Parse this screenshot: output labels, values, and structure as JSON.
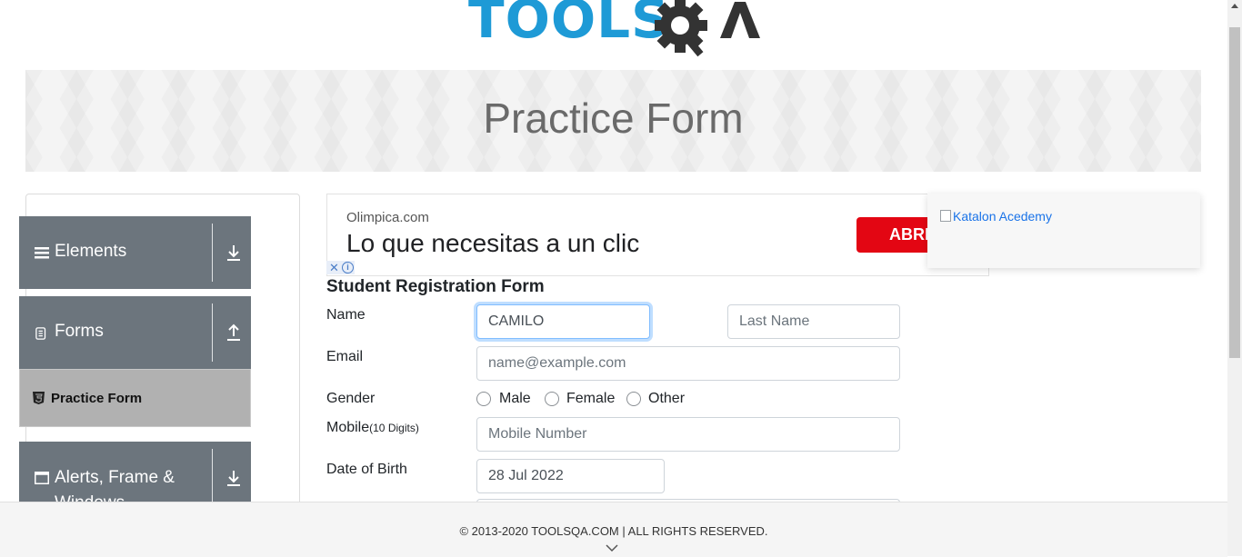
{
  "header": {
    "logo_text": "TOOLS",
    "logo_suffix": "QA"
  },
  "banner": {
    "title": "Practice Form"
  },
  "sidebar": {
    "groups": [
      {
        "label": "Elements",
        "icon": "hamburger-icon",
        "toggle": "download-arrow-icon"
      },
      {
        "label": "Forms",
        "icon": "document-icon",
        "toggle": "upload-arrow-icon"
      },
      {
        "label": "Alerts, Frame & Windows",
        "icon": "window-icon",
        "toggle": "download-arrow-icon"
      }
    ],
    "active_item": {
      "label": "Practice Form",
      "icon": "html5-shield-icon"
    }
  },
  "ad": {
    "domain": "Olimpica.com",
    "headline": "Lo que necesitas a un clic",
    "button_label": "ABRIR"
  },
  "katalon": {
    "alt_text": "Katalon Acedemy"
  },
  "form": {
    "title": "Student Registration Form",
    "name_label": "Name",
    "first_name_value": "CAMILO",
    "last_name_placeholder": "Last Name",
    "email_label": "Email",
    "email_placeholder": "name@example.com",
    "gender_label": "Gender",
    "gender_options": [
      "Male",
      "Female",
      "Other"
    ],
    "mobile_label": "Mobile",
    "mobile_hint": "(10 Digits)",
    "mobile_placeholder": "Mobile Number",
    "dob_label": "Date of Birth",
    "dob_value": "28 Jul 2022"
  },
  "footer": {
    "copyright": "© 2013-2020 TOOLSQA.COM | ALL RIGHTS RESERVED."
  },
  "colors": {
    "brand_blue": "#1e9ad6",
    "brand_dark": "#333333",
    "sidebar_gray": "#6c757d",
    "ad_red": "#e30613"
  }
}
